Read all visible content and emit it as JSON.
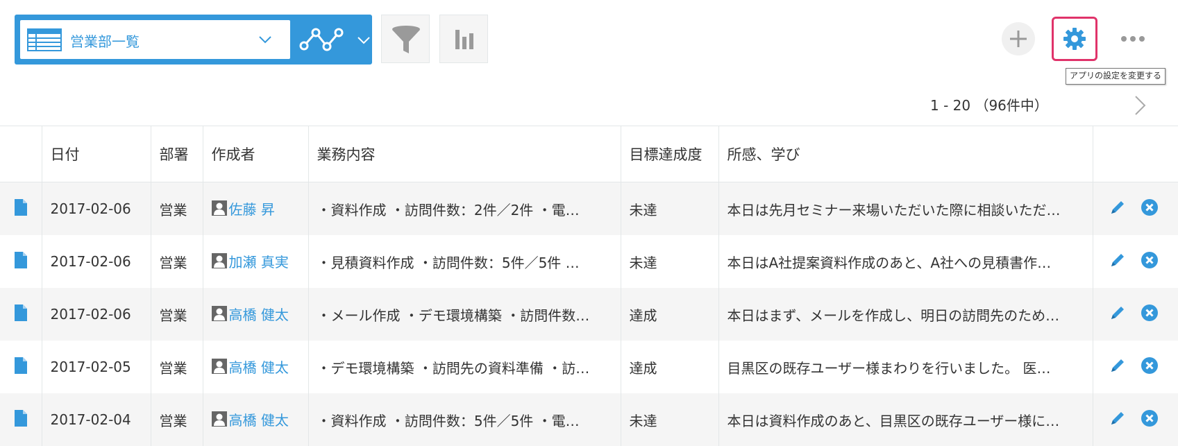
{
  "toolbar": {
    "view_name": "営業部一覧",
    "tooltip": "アプリの設定を変更する"
  },
  "colors": {
    "accent": "#3498db",
    "highlight": "#e0336a",
    "row_alt": "#f5f5f5"
  },
  "pagination": {
    "text": "1 - 20 （96件中）"
  },
  "table": {
    "headers": [
      "日付",
      "部署",
      "作成者",
      "業務内容",
      "目標達成度",
      "所感、学び"
    ],
    "rows": [
      {
        "date": "2017-02-06",
        "dept": "営業",
        "creator": "佐藤 昇",
        "task": "・資料作成 ・訪問件数：2件／2件 ・電…",
        "achievement": "未達",
        "thoughts": "本日は先月セミナー来場いただいた際に相談いただ…"
      },
      {
        "date": "2017-02-06",
        "dept": "営業",
        "creator": "加瀬 真実",
        "task": "・見積資料作成 ・訪問件数：5件／5件 …",
        "achievement": "未達",
        "thoughts": "本日はA社提案資料作成のあと、A社への見積書作…"
      },
      {
        "date": "2017-02-06",
        "dept": "営業",
        "creator": "高橋 健太",
        "task": "・メール作成 ・デモ環境構築 ・訪問件数…",
        "achievement": "達成",
        "thoughts": "本日はまず、メールを作成し、明日の訪問先のため…"
      },
      {
        "date": "2017-02-05",
        "dept": "営業",
        "creator": "高橋 健太",
        "task": "・デモ環境構築 ・訪問先の資料準備 ・訪…",
        "achievement": "達成",
        "thoughts": "目黒区の既存ユーザー様まわりを行いました。 医…"
      },
      {
        "date": "2017-02-04",
        "dept": "営業",
        "creator": "高橋 健太",
        "task": "・資料作成 ・訪問件数：5件／5件 ・電…",
        "achievement": "未達",
        "thoughts": "本日は資料作成のあと、目黒区の既存ユーザー様に…"
      }
    ]
  },
  "icons": {
    "view": "list-view-icon",
    "graph": "line-graph-icon",
    "filter": "filter-icon",
    "graphs": "bar-chart-icon",
    "add": "plus-icon",
    "settings": "gear-icon",
    "more": "more-icon",
    "next": "chevron-right-icon",
    "record": "document-icon",
    "edit": "pencil-icon",
    "delete": "close-circle-icon",
    "user": "user-avatar-icon"
  }
}
